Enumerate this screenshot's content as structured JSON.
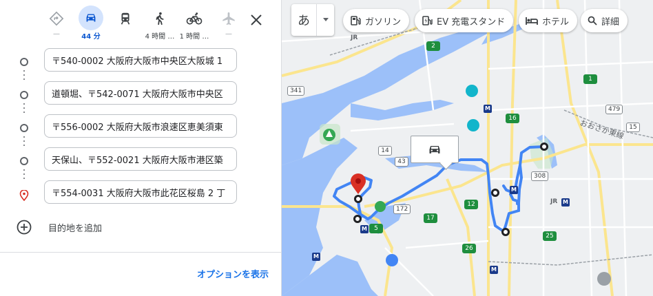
{
  "travel_modes": [
    {
      "name": "best",
      "label": "—"
    },
    {
      "name": "driving",
      "label": "44 分"
    },
    {
      "name": "transit",
      "label": ""
    },
    {
      "name": "walking",
      "label": "4 時間 …"
    },
    {
      "name": "cycling",
      "label": "1 時間 …"
    },
    {
      "name": "flight",
      "label": "—"
    }
  ],
  "stops": [
    "〒540-0002 大阪府大阪市中央区大阪城 1",
    "道頓堀、〒542-0071 大阪府大阪市中央区",
    "〒556-0002 大阪府大阪市浪速区恵美須東",
    "天保山、〒552-0021 大阪府大阪市港区築",
    "〒554-0031 大阪府大阪市此花区桜島 2 丁"
  ],
  "add_destination": "目的地を追加",
  "options_link": "オプションを表示",
  "map": {
    "ime_char": "あ",
    "chips": [
      "ガソリン",
      "EV 充電スタンド",
      "ホテル",
      "詳細"
    ],
    "label_osaka_loop": "おおさか東線",
    "shields": [
      "341",
      "43",
      "172",
      "17",
      "5",
      "2",
      "1",
      "16",
      "479",
      "308",
      "15",
      "12",
      "25",
      "14",
      "26"
    ],
    "route_color": "#4285f4"
  }
}
